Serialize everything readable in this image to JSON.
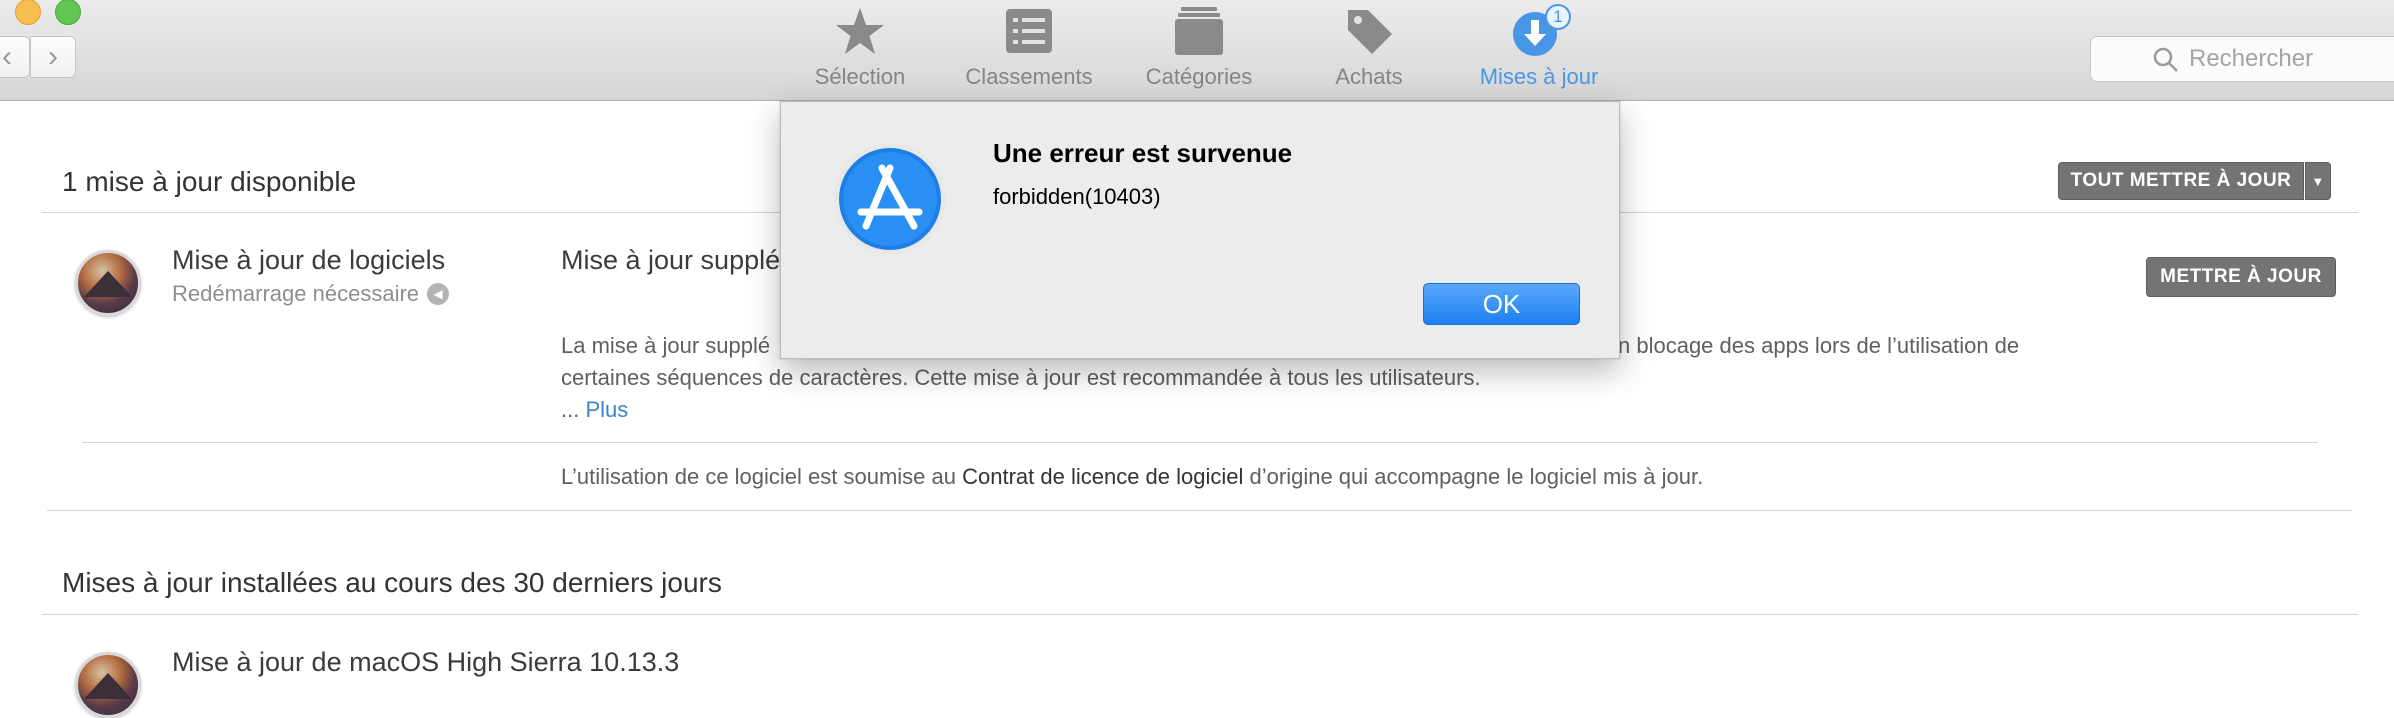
{
  "toolbar": {
    "tabs": [
      {
        "label": "Sélection",
        "icon": "star-icon"
      },
      {
        "label": "Classements",
        "icon": "list-icon"
      },
      {
        "label": "Catégories",
        "icon": "stack-icon"
      },
      {
        "label": "Achats",
        "icon": "tag-icon"
      },
      {
        "label": "Mises à jour",
        "icon": "updates-icon",
        "badge": "1",
        "active": true
      }
    ],
    "search_placeholder": "Rechercher"
  },
  "available": {
    "title": "1 mise à jour disponible",
    "update_all_label": "TOUT METTRE À JOUR",
    "item": {
      "name": "Mise à jour de logiciels",
      "subtitle": "Redémarrage nécessaire",
      "headline": "Mise à jour supplé",
      "update_label": "METTRE À JOUR",
      "desc_line1_start": "La mise à jour supplé",
      "desc_line1_end": "n blocage des apps lors de l’utilisation de",
      "desc_line2": "certaines séquences de caractères. Cette mise à jour est recommandée à tous les utilisateurs.",
      "ellipsis": "... ",
      "more_label": "Plus",
      "license_prefix": "L’utilisation de ce logiciel est soumise au ",
      "license_link": "Contrat de licence de logiciel",
      "license_suffix": " d’origine qui accompagne le logiciel mis à jour."
    }
  },
  "installed": {
    "title": "Mises à jour installées au cours des 30 derniers jours",
    "item_name": "Mise à jour de macOS High Sierra 10.13.3"
  },
  "dialog": {
    "title": "Une erreur est survenue",
    "message": "forbidden(10403)",
    "ok_label": "OK"
  },
  "colors": {
    "accent": "#4a96e6",
    "button_gray": "#747474",
    "ok_blue": "#1e80f0"
  }
}
